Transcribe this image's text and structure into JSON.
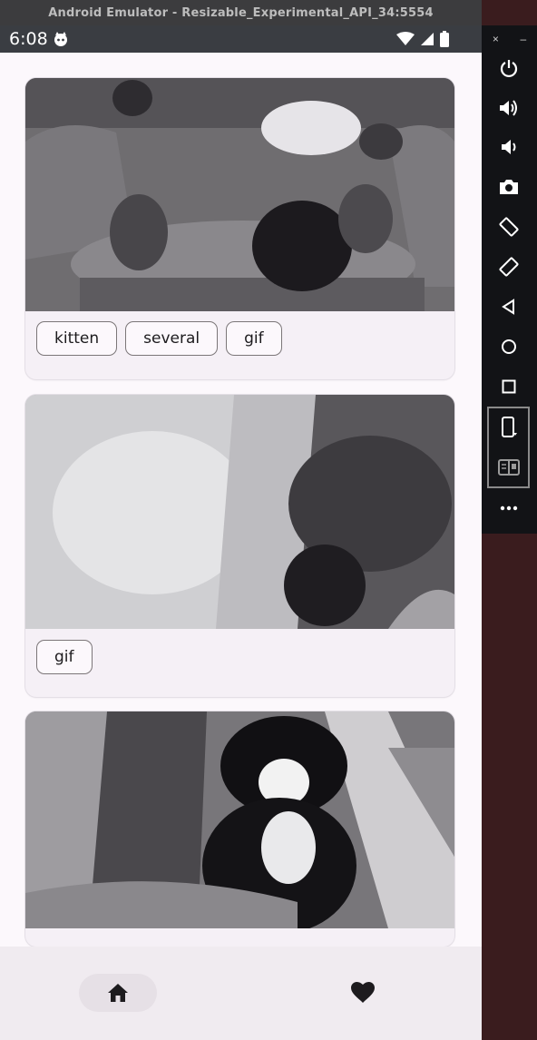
{
  "window": {
    "title": "Android Emulator - Resizable_Experimental_API_34:5554"
  },
  "statusbar": {
    "time": "6:08"
  },
  "cards": [
    {
      "tags": [
        "kitten",
        "several",
        "gif"
      ]
    },
    {
      "tags": [
        "gif"
      ]
    },
    {
      "tags": []
    }
  ],
  "bottom_nav": {
    "items": [
      "home-icon",
      "heart-icon"
    ]
  },
  "side_toolbar": {
    "top": [
      "×",
      "–"
    ],
    "buttons": [
      "power-icon",
      "volume-up-icon",
      "volume-down-icon",
      "camera-icon",
      "rotate-left-icon",
      "rotate-right-icon",
      "back-icon",
      "home-circle-icon",
      "overview-icon",
      "fold-device-icon",
      "display-mode-icon",
      "more-icon"
    ]
  },
  "colors": {
    "accent": "#1d1b1e",
    "surface": "#fcf8fc",
    "card": "#f5f0f6",
    "emulator_frame": "#3a1c1e"
  }
}
